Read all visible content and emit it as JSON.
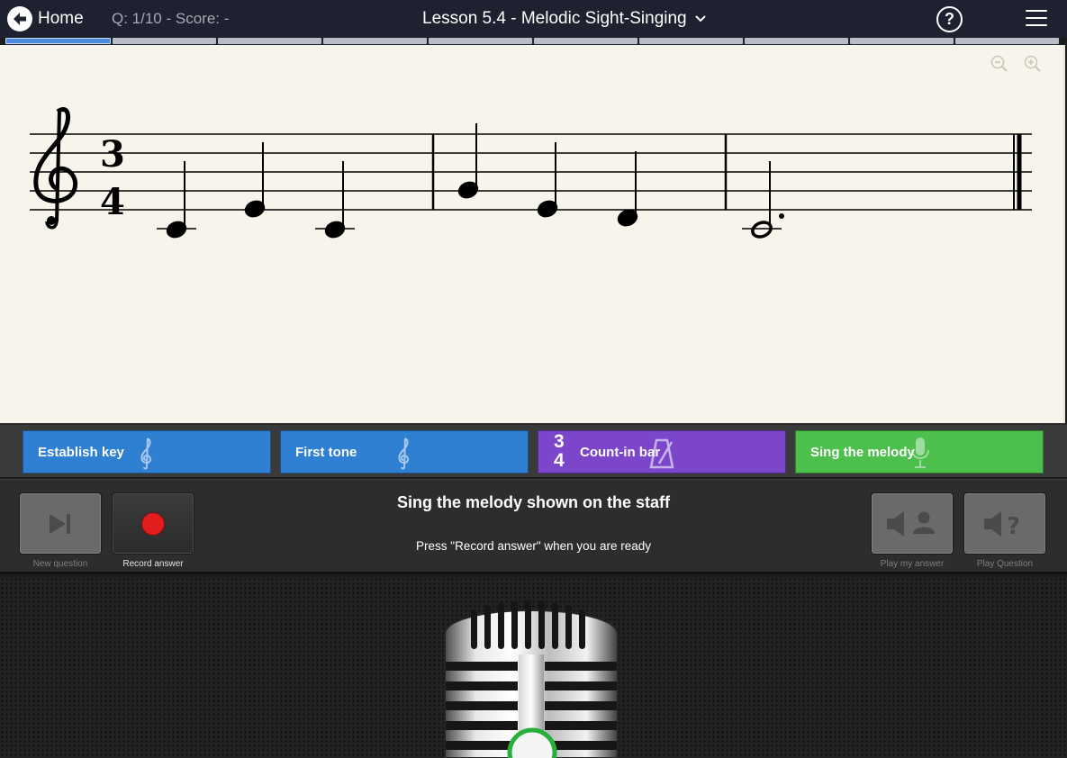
{
  "topbar": {
    "home_label": "Home",
    "question_score": "Q: 1/10 - Score: -",
    "lesson_title": "Lesson 5.4 - Melodic Sight-Singing"
  },
  "progress": {
    "total": 10,
    "current": 1
  },
  "staff": {
    "time_signature": {
      "top": "3",
      "bottom": "4"
    }
  },
  "steps": [
    {
      "label": "Establish key",
      "icon": "treble-clef-icon",
      "color": "#2f7fd3"
    },
    {
      "label": "First tone",
      "icon": "treble-clef-icon",
      "color": "#2f7fd3"
    },
    {
      "label": "Count-in bar",
      "icon": "metronome-icon",
      "color": "#7b46c9",
      "time_top": "3",
      "time_bottom": "4"
    },
    {
      "label": "Sing the melody",
      "icon": "microphone-icon",
      "color": "#4cbf4d"
    }
  ],
  "controls": {
    "new_question": "New question",
    "record_answer": "Record answer",
    "play_my_answer": "Play my answer",
    "play_question": "Play Question",
    "instruction": "Sing the melody shown on the staff",
    "hint": "Press \"Record answer\" when you are ready"
  },
  "colors": {
    "record_dot": "#e01e1e",
    "mic_ring": "#26b03a",
    "topbar": "#1e2230",
    "paper": "#f7f5eb"
  }
}
